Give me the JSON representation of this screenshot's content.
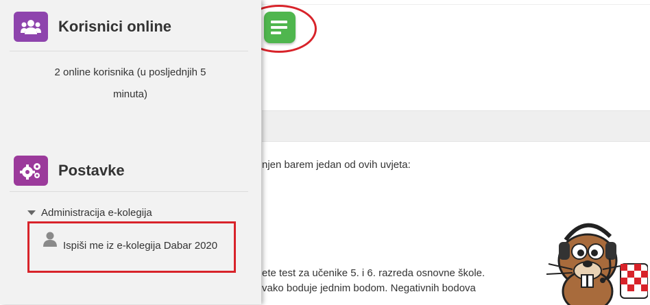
{
  "online_users": {
    "title": "Korisnici online",
    "icon": "users-icon",
    "status_text": "2 online korisnika (u posljednjih 5 minuta)",
    "status_line1": "2 online korisnika (u posljednjih 5",
    "status_line2": "minuta)"
  },
  "settings": {
    "title": "Postavke",
    "icon": "cogs-icon",
    "admin_label": "Administracija e-kolegija",
    "unenrol_label": "Ispiši me iz e-kolegija Dabar 2020"
  },
  "main": {
    "drawer_toggle_icon": "drawer-toggle-icon",
    "text_line1": "njen barem jedan od ovih uvjeta:",
    "text_line2": "ete test za učenike 5. i 6. razreda osnovne škole.",
    "text_line3": "vako boduje jednim bodom. Negativnih bodova"
  },
  "colors": {
    "block_icon": "#8e44ad",
    "drawer_toggle": "#4fb64e",
    "annotation_red": "#d8232a"
  }
}
